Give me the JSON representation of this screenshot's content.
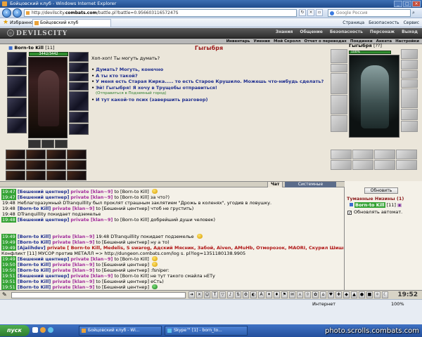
{
  "window": {
    "title": "Бойцовский клуб - Windows Internet Explorer"
  },
  "browser": {
    "address": "http://devilscity.",
    "address_domain": "combats.com",
    "address_rest": "/battle.pl?battle=0.95660311657247S",
    "search_placeholder": "Google Россия",
    "favorites_label": "Избранное",
    "tab_label": "Бойцовский клуб",
    "commands": [
      "Страница",
      "Безопасность",
      "Сервис"
    ]
  },
  "game": {
    "logo": "DEVILSCITY",
    "nav": [
      "Знания",
      "Общение",
      "Безопасность",
      "Персонаж",
      "Выход"
    ],
    "subnav": [
      "Инвентарь",
      "Умения",
      "Мой Скролл",
      "Отчет о переводах",
      "Поединки",
      "Анкета",
      "Настройки"
    ],
    "player": {
      "name": "Born-to Kill",
      "level": "[11]",
      "hp": "3442/3442"
    },
    "npc_title": "Гыгыбря",
    "npc": {
      "name": "Гыгыбря",
      "level": "[??]",
      "hp": "100%"
    },
    "dialog_prompt": "Хоп-хоп! Ты могуть думать?",
    "dialog_options": [
      "Думать? Могуть, конечно",
      "А ты кто такой?",
      "У меня есть Старая Кирка..... то есть Старое Крушило. Можешь что-нибудь сделать?",
      "Эй! Гыгыбря! Я хочу в Трущобы отправиться!"
    ],
    "dialog_note": "(Отправиться в Подземный город)",
    "dialog_last": "И тут какой-то псих (завершить разговор)"
  },
  "chat": {
    "tabs": [
      "Чат",
      "Системные сообщения"
    ],
    "lines": [
      {
        "ts": "19:47",
        "hl": true,
        "room": "[Бешений центнер]",
        "priv": "private [klan~9]",
        "rest": "to [Born-to Kill]",
        "smile": "y"
      },
      {
        "ts": "19:47",
        "hl": true,
        "room": "[Бешений центнер]",
        "priv": "private [klan~9]",
        "rest": "to [Born-to Kill] за что?)"
      },
      {
        "ts": "19:48",
        "hl": false,
        "text": "Неблагоразумный DTranquillity был проклят страшным заклятием \"Дрожь в коленях\", угодив в ловушку."
      },
      {
        "ts": "19:48",
        "hl": false,
        "nick": "[Born-to Kill]",
        "priv": "private [klan~9]",
        "rest": "to [Бешений центнер] чтоб не грустить)"
      },
      {
        "ts": "19:48",
        "hl": false,
        "text": "DTranquillity покидает подземелье"
      },
      {
        "ts": "19:48",
        "hl": true,
        "room": "[Бешений центнер]",
        "priv": "private [klan~9]",
        "rest": "to [Born-to Kill] добрейший души человек)"
      },
      {
        "ts": "19:49",
        "hl": true,
        "nick": "[Born-to Kill]",
        "priv": "private [klan~9]",
        "rest": "19:48 DTranquillity покидает подземелье",
        "smile": "y"
      },
      {
        "ts": "19:49",
        "hl": true,
        "nick": "[Born-to Kill]",
        "priv": "private [klan~9]",
        "rest": "to [Бешений центнер] ну а то)"
      },
      {
        "ts": "19:49",
        "hl": true,
        "nick": "[Ajaiihdev]",
        "red": "private [ Born-to Kill, Medelis, S swarog, Адский Мясник, Забой, Aiven, AMuHb, Отморозок, MAORI, Скурил Шишку ]"
      },
      {
        "ts": "",
        "hl": false,
        "text": "Конфликт [11] МУСОР против МЕТАЛЛ => http://dungeon.combats.com/log s. pl?log=1351180138.9905"
      },
      {
        "ts": "19:49",
        "hl": true,
        "room": "[Бешений центнер]",
        "priv": "private [klan~9]",
        "rest": "to [Born-to Kill]",
        "smile": "y"
      },
      {
        "ts": "19:50",
        "hl": true,
        "nick": "[Born-to Kill]",
        "priv": "private [klan~9]",
        "rest": "to [Бешений центнер]",
        "smile": "y"
      },
      {
        "ts": "19:50",
        "hl": true,
        "nick": "[Born-to Kill]",
        "priv": "private [klan~9]",
        "rest": "to [Бешений центнер] :fsniper:"
      },
      {
        "ts": "19:51",
        "hl": true,
        "room": "[Бешений центнер]",
        "priv": "private [klan~9]",
        "rest": "to [Born-to Kill] не тут такого смайла нЕТу"
      },
      {
        "ts": "19:51",
        "hl": true,
        "nick": "[Born-to Kill]",
        "priv": "private [klan~9]",
        "rest": "to [Бешений центнер] еСть)"
      },
      {
        "ts": "19:51",
        "hl": true,
        "nick": "[Born-to Kill]",
        "priv": "private [klan~9]",
        "rest": "to [Бешений центнер]",
        "smile": "g"
      }
    ]
  },
  "online": {
    "refresh_label": "Обновить",
    "location": "Туманные Низины (1)",
    "user": "Born-to Kill",
    "user_level": "[11]",
    "auto_label": "Обновлять автомат."
  },
  "status": {
    "internet": "Интернет",
    "zoom": "100%"
  },
  "clock": "19:52",
  "taskbar": {
    "start": "пуск",
    "tasks": [
      "Бойцовский клуб - Wi...",
      "Skype™ [1] - born_to..."
    ]
  },
  "watermark": "photo.scrolls.combats.com"
}
